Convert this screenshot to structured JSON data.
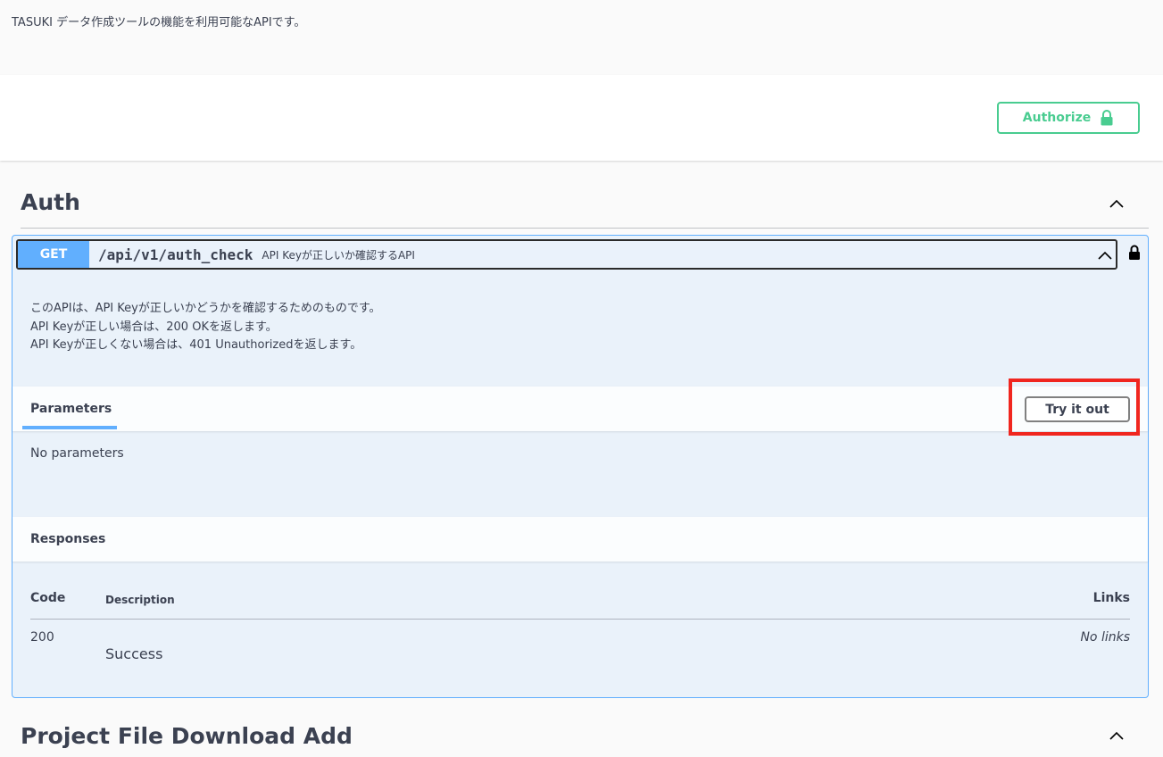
{
  "info": {
    "description": "TASUKI データ作成ツールの機能を利用可能なAPIです。"
  },
  "scheme": {
    "authorize_label": "Authorize"
  },
  "tags": [
    {
      "name": "Auth",
      "operations": [
        {
          "method": "GET",
          "path": "/api/v1/auth_check",
          "summary": "API Keyが正しいか確認するAPI",
          "description_lines": [
            "このAPIは、API Keyが正しいかどうかを確認するためのものです。",
            "API Keyが正しい場合は、200 OKを返します。",
            "API Keyが正しくない場合は、401 Unauthorizedを返します。"
          ],
          "parameters_tab": "Parameters",
          "try_it_out_label": "Try it out",
          "no_parameters": "No parameters",
          "responses_title": "Responses",
          "responses_table": {
            "headers": {
              "code": "Code",
              "description": "Description",
              "links": "Links"
            },
            "rows": [
              {
                "code": "200",
                "description": "Success",
                "links": "No links"
              }
            ]
          }
        }
      ]
    },
    {
      "name": "Project File Download Add"
    }
  ],
  "colors": {
    "get_method": "#61affe",
    "authorize": "#49cc90",
    "highlight": "#f0261f"
  }
}
